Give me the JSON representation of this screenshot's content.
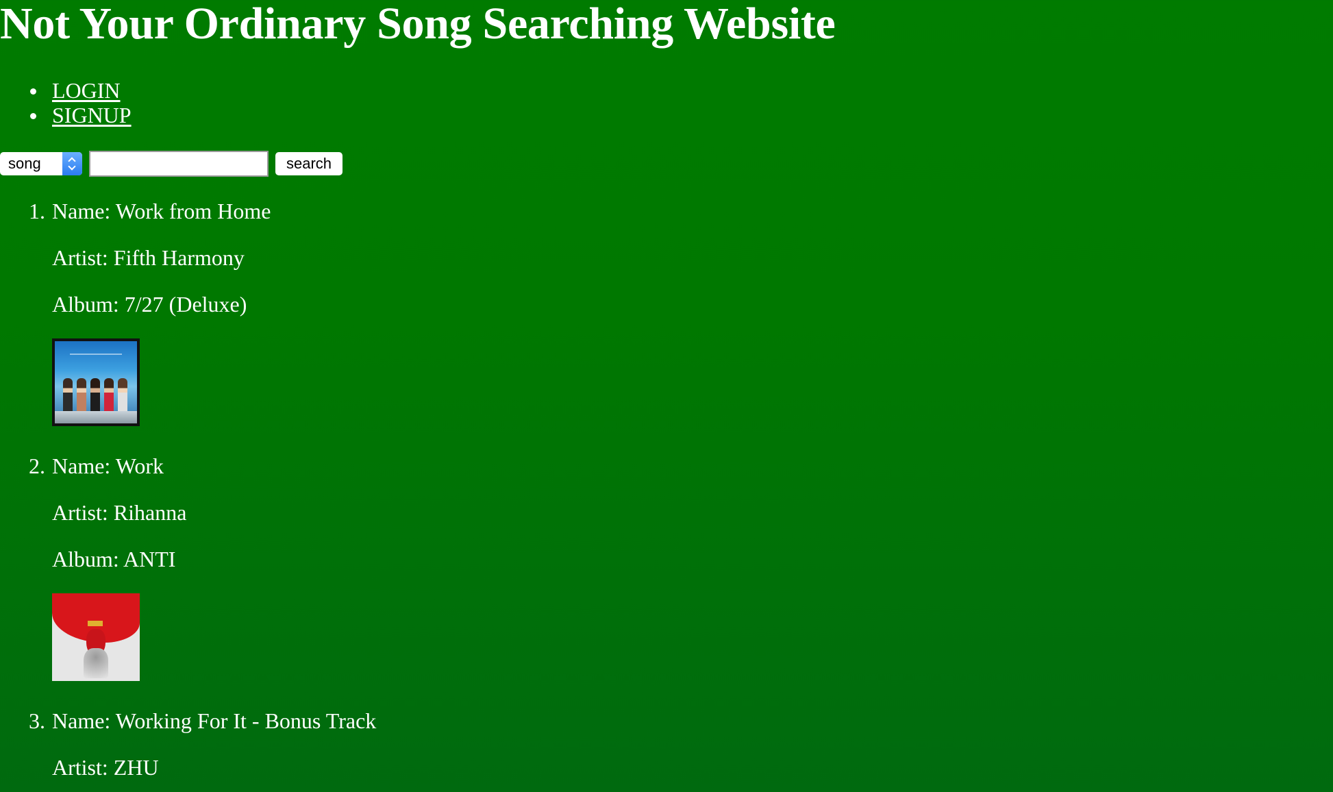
{
  "header": {
    "title": "Not Your Ordinary Song Searching Website"
  },
  "nav": {
    "links": [
      {
        "label": "LOGIN"
      },
      {
        "label": "SIGNUP"
      }
    ]
  },
  "search": {
    "type_selected": "song",
    "query_value": "",
    "button_label": "search"
  },
  "results": [
    {
      "number": "1.",
      "name": "Name: Work from Home",
      "artist": "Artist: Fifth Harmony",
      "album": "Album: 7/27 (Deluxe)",
      "cover_icon": "album-cover-7-27"
    },
    {
      "number": "2.",
      "name": "Name: Work",
      "artist": "Artist: Rihanna",
      "album": "Album: ANTI",
      "cover_icon": "album-cover-anti"
    },
    {
      "number": "3.",
      "name": "Name: Working For It - Bonus Track",
      "artist": "Artist: ZHU",
      "album": "",
      "cover_icon": ""
    }
  ],
  "colors": {
    "background": "#007b00",
    "text": "#ffffff",
    "select_accent": "#2a7cf0"
  }
}
